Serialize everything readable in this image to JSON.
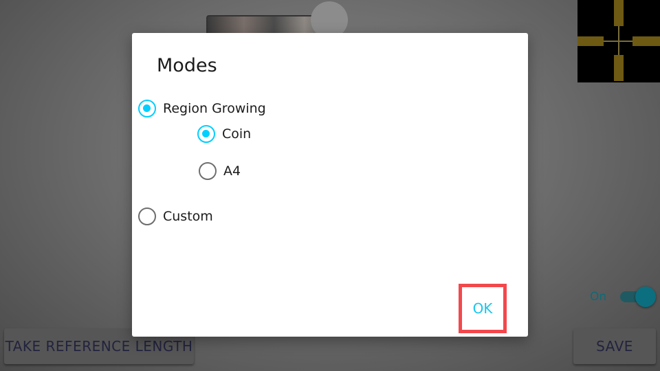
{
  "dialog": {
    "title": "Modes",
    "options": {
      "region_growing": {
        "label": "Region Growing",
        "checked": true
      },
      "coin": {
        "label": "Coin",
        "checked": true
      },
      "a4": {
        "label": "A4",
        "checked": false
      },
      "custom": {
        "label": "Custom",
        "checked": false
      }
    },
    "ok_label": "OK"
  },
  "background": {
    "take_reference_label": "TAKE REFERENCE LENGTH",
    "save_label": "SAVE",
    "toggle_label": "On"
  },
  "colors": {
    "accent": "#00cfff",
    "ok_text": "#19c6ee",
    "highlight_border": "#f2484c",
    "crosshair_arm": "#6e5a12"
  },
  "icons": [
    "crosshair-icon",
    "radio-checked-icon",
    "radio-unchecked-icon"
  ]
}
